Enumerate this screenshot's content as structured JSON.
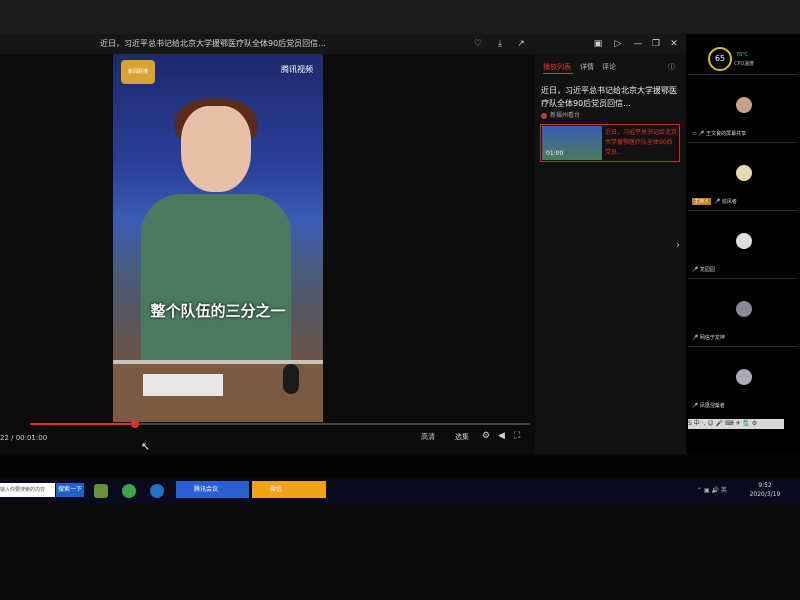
{
  "player": {
    "title": "近日，习近平总书记给北京大学援鄂医疗队全体90后党员回信...",
    "time": "22 / 00:01:00",
    "quality_label": "高清",
    "episodes_label": "选集",
    "progress_fraction": 0.21
  },
  "video": {
    "cctv_logo": "新闻联播",
    "watermark": "腾讯视频",
    "subtitle": "整个队伍的三分之一"
  },
  "panel": {
    "tabs": [
      "播放列表",
      "详情",
      "评论"
    ],
    "title": "近日，习近平总书记给北京大学援鄂医疗队全体90后党员回信...",
    "author": "新福州看台",
    "related": {
      "duration": "01:00",
      "title": "近日，习近平总书记给北京大学援鄂医疗队全体90后党员..."
    }
  },
  "meeting": {
    "cpu_percent": "65",
    "cpu_temp": "78°C",
    "cpu_label": "CPU温度",
    "participants": [
      {
        "name": "王文良的屏幕共享"
      },
      {
        "name": "追风者",
        "badge": "主持人"
      },
      {
        "name": "龙园园"
      },
      {
        "name": "网信于龙坤"
      },
      {
        "name": "凤凰涅槃者"
      }
    ],
    "input_bar": "S 中 ·, ☺ 🎤 ⌨ ✈ 🎽 ⚙"
  },
  "taskbar": {
    "search_placeholder": "输入你要搜索的内容",
    "search_button": "搜索一下",
    "tasks": [
      "腾讯会议",
      "微信"
    ],
    "time": "9:52",
    "date": "2020/3/19",
    "colors": {
      "meeting": "#2b5fd1",
      "wechat": "#f0a21a"
    }
  }
}
